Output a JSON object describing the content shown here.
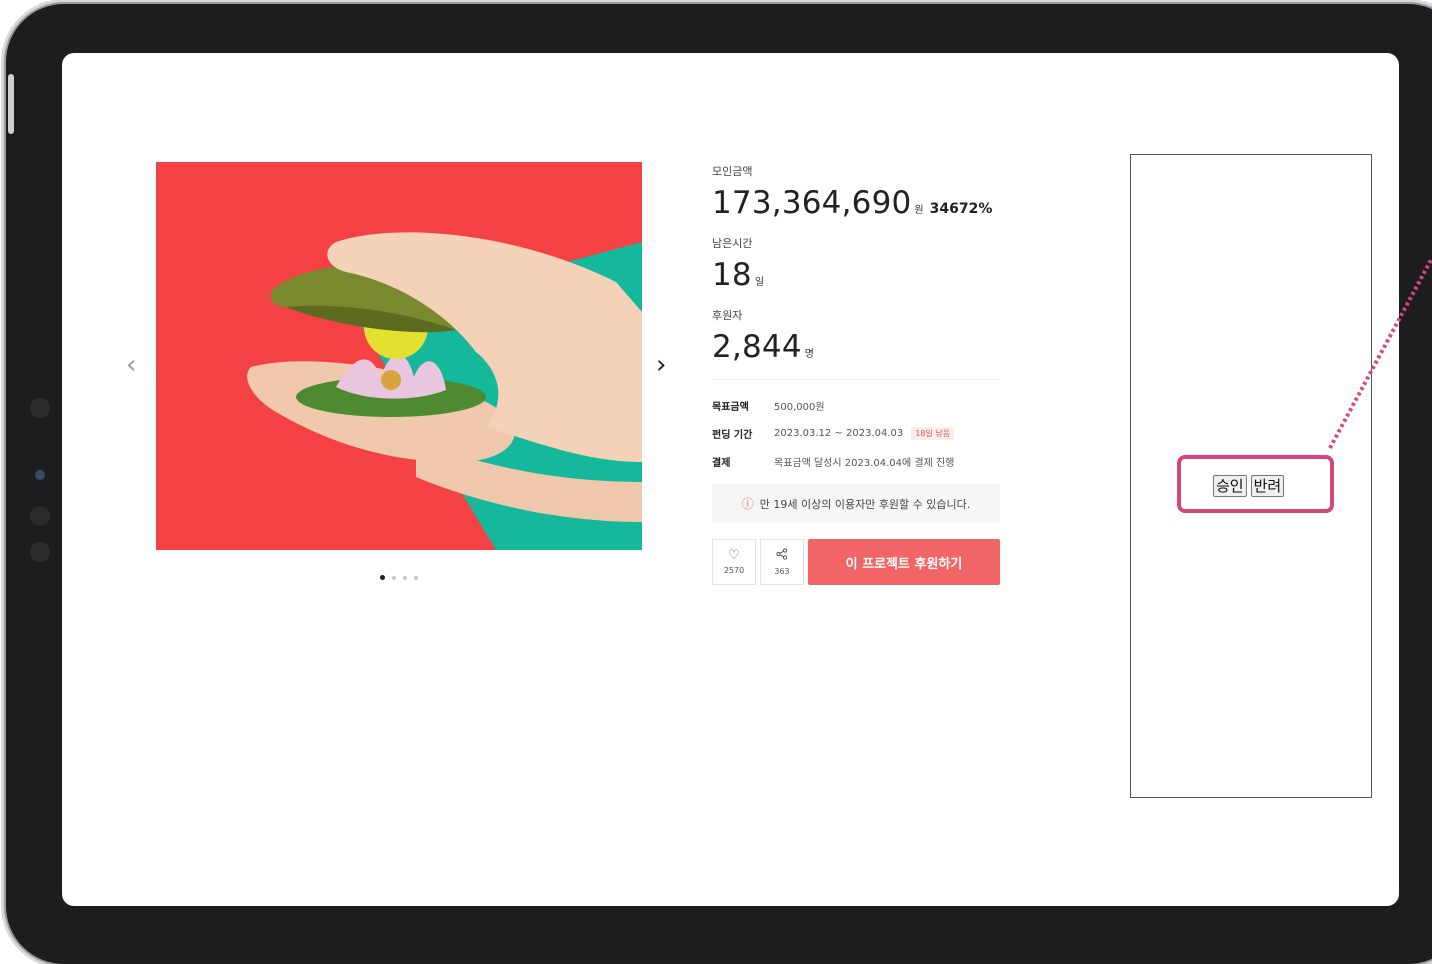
{
  "stats": {
    "raised_label": "모인금액",
    "raised_value": "173,364,690",
    "raised_unit": "원",
    "raised_percent": "34672%",
    "remaining_label": "남은시간",
    "remaining_value": "18",
    "remaining_unit": "일",
    "backers_label": "후원자",
    "backers_value": "2,844",
    "backers_unit": "명"
  },
  "details": {
    "goal_key": "목표금액",
    "goal_value": "500,000원",
    "period_key": "펀딩 기간",
    "period_value": "2023.03.12 ~ 2023.04.03",
    "period_badge": "18일 남음",
    "payment_key": "결제",
    "payment_value": "목표금액 달성시 2023.04.04에 결제 진행"
  },
  "notice": {
    "icon": "info-circle-icon",
    "glyph": "ⓘ",
    "text": "만 19세 이상의 이용자만 후원할 수 있습니다."
  },
  "actions": {
    "like_glyph": "♡",
    "like_count": "2570",
    "share_glyph": "⋞",
    "share_count": "363",
    "back_label": "이 프로젝트 후원하기"
  },
  "carousel": {
    "prev_glyph": "‹",
    "next_glyph": "›",
    "slide_count": 4,
    "active_slide": 1
  },
  "admin": {
    "approve_label": "승인",
    "reject_label": "반려"
  },
  "colors": {
    "accent": "#f26566",
    "highlight": "#d5467e",
    "photo_red": "#f44244",
    "photo_teal": "#16b89b"
  }
}
